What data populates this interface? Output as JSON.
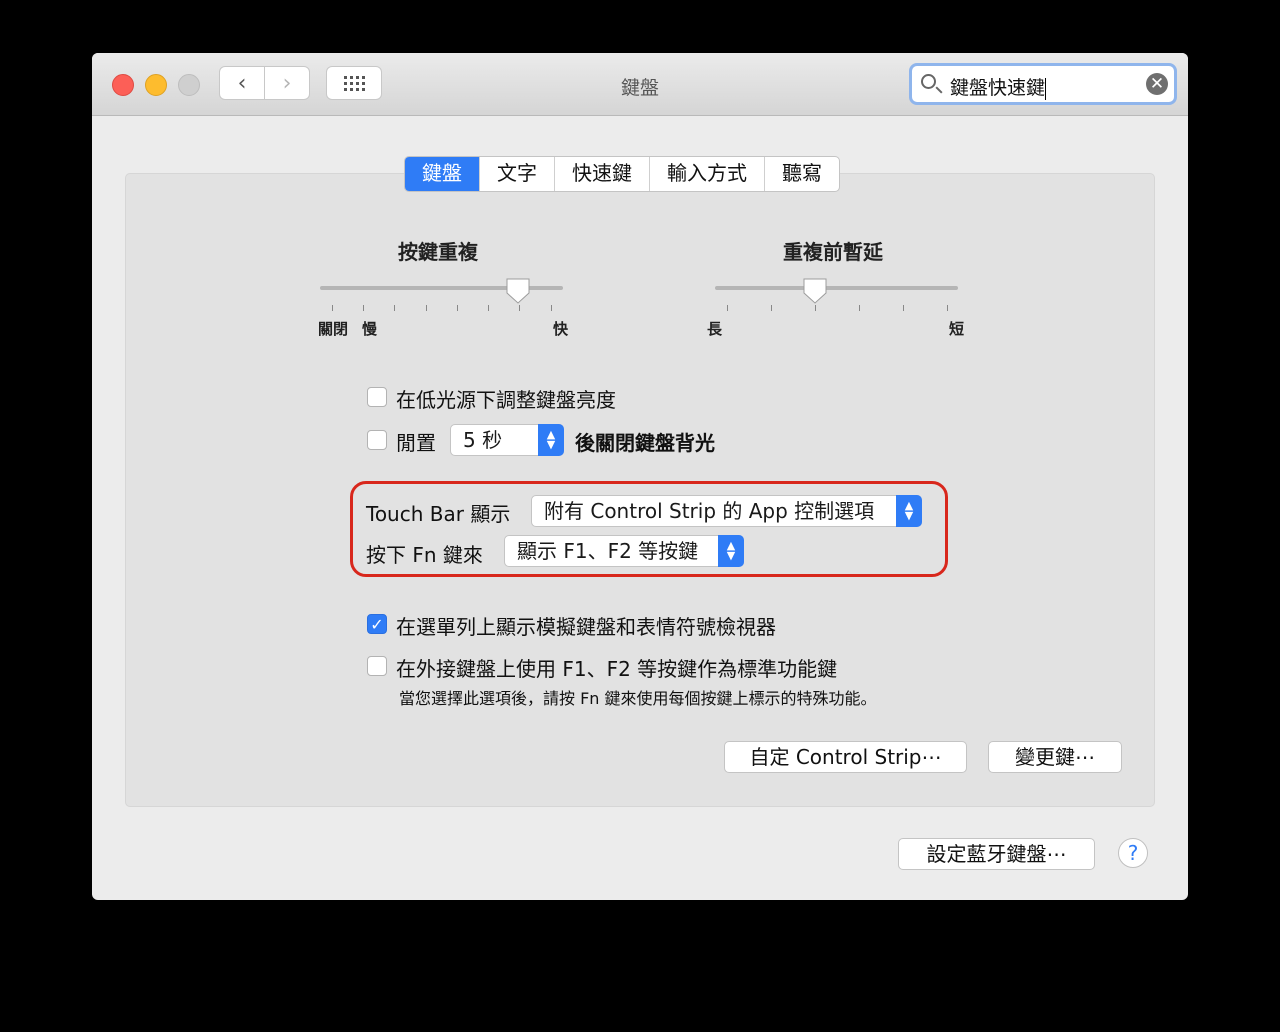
{
  "window": {
    "title": "鍵盤",
    "search_value": "鍵盤快速鍵",
    "clear_glyph": "✕",
    "nav_back": "‹",
    "nav_forward": "›"
  },
  "tabs": [
    {
      "label": "鍵盤",
      "active": true
    },
    {
      "label": "文字",
      "active": false
    },
    {
      "label": "快速鍵",
      "active": false
    },
    {
      "label": "輸入方式",
      "active": false
    },
    {
      "label": "聽寫",
      "active": false
    }
  ],
  "key_repeat": {
    "label": "按鍵重複",
    "left_label_1": "關閉",
    "left_label_2": "慢",
    "right_label": "快"
  },
  "delay_until_repeat": {
    "label": "重複前暫延",
    "left_label": "長",
    "right_label": "短"
  },
  "options": {
    "low_light": {
      "label": "在低光源下調整鍵盤亮度",
      "checked": false
    },
    "idle": {
      "label": "閒置",
      "checked": false,
      "select_value": "5 秒",
      "suffix": "後關閉鍵盤背光"
    },
    "touchbar": {
      "label": "Touch Bar 顯示",
      "select_value": "附有 Control Strip 的 App 控制選項"
    },
    "fn_key": {
      "label": "按下 Fn 鍵來",
      "select_value": "顯示 F1、F2 等按鍵"
    },
    "show_viewer": {
      "label": "在選單列上顯示模擬鍵盤和表情符號檢視器",
      "checked": true
    },
    "f_keys": {
      "label": "在外接鍵盤上使用 F1、F2 等按鍵作為標準功能鍵",
      "checked": false,
      "hint": "當您選擇此選項後，請按 Fn 鍵來使用每個按鍵上標示的特殊功能。"
    }
  },
  "buttons": {
    "customize_strip": "自定 Control Strip⋯",
    "modifier_keys": "變更鍵⋯",
    "bluetooth": "設定藍牙鍵盤⋯",
    "help": "?"
  },
  "checkmark": "✓",
  "popup_arrows": {
    "up": "▲",
    "down": "▼"
  },
  "colors": {
    "accent": "#2f7cf6",
    "highlight_box": "#d8271c"
  }
}
